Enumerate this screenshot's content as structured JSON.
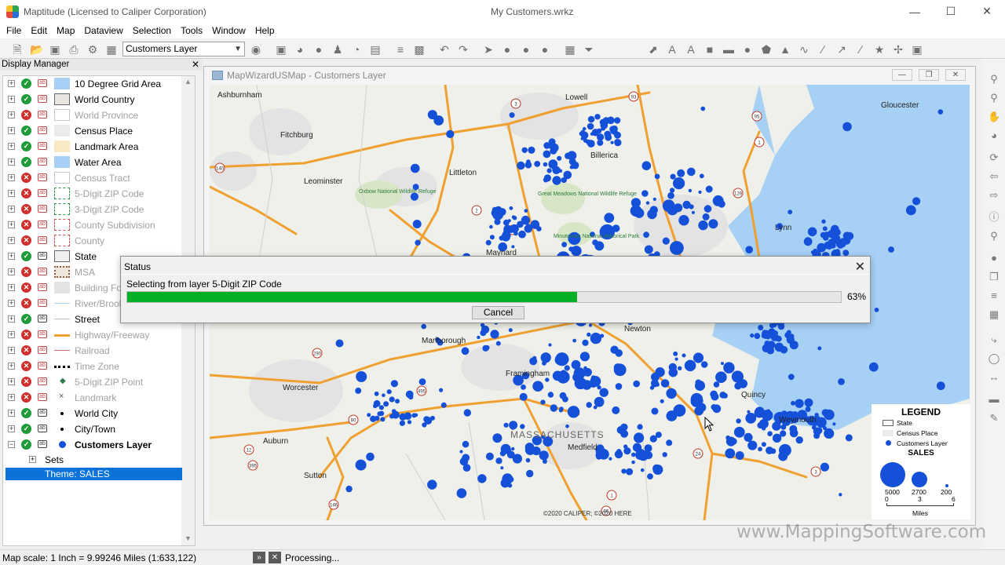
{
  "window": {
    "app_title": "Maptitude (Licensed to Caliper Corporation)",
    "doc_title": "My Customers.wrkz",
    "controls": [
      "minimize-icon",
      "maximize-icon",
      "close-icon"
    ]
  },
  "menu": [
    "File",
    "Edit",
    "Map",
    "Dataview",
    "Selection",
    "Tools",
    "Window",
    "Help"
  ],
  "toolbar": {
    "layer_select": "Customers Layer"
  },
  "display_manager": {
    "title": "Display Manager",
    "layers": [
      {
        "name": "10 Degree Grid Area",
        "visible": true,
        "hidden_label": false,
        "swatch": "#a7d0f5"
      },
      {
        "name": "World Country",
        "visible": true,
        "hidden_label": false,
        "swatch": "#e9e6e1"
      },
      {
        "name": "World Province",
        "visible": false,
        "hidden_label": true,
        "swatch": "#ffffff"
      },
      {
        "name": "Census Place",
        "visible": true,
        "hidden_label": false,
        "swatch": "#ebebeb"
      },
      {
        "name": "Landmark Area",
        "visible": true,
        "hidden_label": false,
        "swatch": "#f7e9c1"
      },
      {
        "name": "Water Area",
        "visible": true,
        "hidden_label": false,
        "swatch": "#a7d0f5"
      },
      {
        "name": "Census Tract",
        "visible": false,
        "hidden_label": true,
        "swatch": "#ffffff"
      },
      {
        "name": "5-Digit ZIP Code",
        "visible": false,
        "hidden_label": true,
        "swatch": "#ffffff"
      },
      {
        "name": "3-Digit ZIP Code",
        "visible": false,
        "hidden_label": true,
        "swatch": "#ffffff"
      },
      {
        "name": "County Subdivision",
        "visible": false,
        "hidden_label": true,
        "swatch": "#ffffff"
      },
      {
        "name": "County",
        "visible": false,
        "hidden_label": true,
        "swatch": "#ffffff"
      },
      {
        "name": "State",
        "visible": true,
        "hidden_label": false,
        "swatch": "#f0f0f0"
      },
      {
        "name": "MSA",
        "visible": false,
        "hidden_label": true,
        "swatch": "#f0e7dc"
      },
      {
        "name": "Building Footprint",
        "visible": false,
        "hidden_label": true,
        "swatch": "#e4e4e4"
      },
      {
        "name": "River/Brook",
        "visible": false,
        "hidden_label": true,
        "swatch": "#a7d0f5"
      },
      {
        "name": "Street",
        "visible": true,
        "hidden_label": false,
        "swatch": "#d8d8d8"
      },
      {
        "name": "Highway/Freeway",
        "visible": false,
        "hidden_label": true,
        "swatch": "#f0a030"
      },
      {
        "name": "Railroad",
        "visible": false,
        "hidden_label": true,
        "swatch": "#c46a6a"
      },
      {
        "name": "Time Zone",
        "visible": false,
        "hidden_label": true,
        "swatch": "#000000"
      },
      {
        "name": "5-Digit ZIP Point",
        "visible": false,
        "hidden_label": true,
        "swatch": "#2a7a4a"
      },
      {
        "name": "Landmark",
        "visible": false,
        "hidden_label": true,
        "swatch": "#555555"
      },
      {
        "name": "World City",
        "visible": true,
        "hidden_label": false,
        "swatch": "#000000"
      },
      {
        "name": "City/Town",
        "visible": true,
        "hidden_label": false,
        "swatch": "#000000"
      },
      {
        "name": "Customers Layer",
        "visible": true,
        "hidden_label": false,
        "swatch": "#1450d8",
        "bold": true
      }
    ],
    "sets_label": "Sets",
    "theme_label": "Theme: SALES"
  },
  "map_window": {
    "title": "MapWizardUSMap - Customers Layer",
    "places": [
      {
        "name": "Ashburnham"
      },
      {
        "name": "Lowell"
      },
      {
        "name": "Gloucester"
      },
      {
        "name": "Fitchburg"
      },
      {
        "name": "Billerica"
      },
      {
        "name": "Littleton"
      },
      {
        "name": "Leominster"
      },
      {
        "name": "Oxbow National Wildlife Refuge"
      },
      {
        "name": "Great Meadows National Wildlife Refuge"
      },
      {
        "name": "Lynn"
      },
      {
        "name": "Minuteman National Historical Park"
      },
      {
        "name": "Maynard"
      },
      {
        "name": "Marlborough"
      },
      {
        "name": "Newton"
      },
      {
        "name": "Worcester"
      },
      {
        "name": "Framingham"
      },
      {
        "name": "Quincy"
      },
      {
        "name": "Weymouth"
      },
      {
        "name": "MASSACHUSETTS"
      },
      {
        "name": "Medfield"
      },
      {
        "name": "Auburn"
      },
      {
        "name": "Sutton"
      }
    ],
    "copyright": "©2020 CALIPER; ©2020 HERE"
  },
  "legend": {
    "title": "LEGEND",
    "items": [
      "State",
      "Census Place",
      "Customers Layer"
    ],
    "theme_title": "SALES",
    "sizes": [
      {
        "label": "5000",
        "value": 5000
      },
      {
        "label": "2700",
        "value": 2700
      },
      {
        "label": "200",
        "value": 200
      }
    ],
    "scale_ticks": [
      "0",
      "3",
      "6"
    ],
    "scale_unit": "Miles"
  },
  "status_dialog": {
    "title": "Status",
    "message": "Selecting from layer 5-Digit ZIP Code",
    "progress": 63,
    "progress_label": "63%",
    "cancel_label": "Cancel"
  },
  "statusbar": {
    "scale_text": "Map scale: 1 Inch = 9.99246 Miles (1:633,122)",
    "processing_text": "Processing..."
  },
  "watermark": "www.MappingSoftware.com",
  "colors": {
    "customer_dot": "#1450d8",
    "highway": "#f0a030",
    "water": "#a7d0f5",
    "progress": "#06b025",
    "selection": "#0a72d8"
  }
}
